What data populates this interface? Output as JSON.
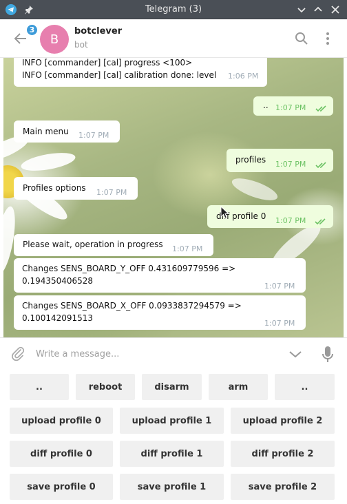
{
  "window": {
    "title": "Telegram (3)"
  },
  "header": {
    "unread_badge": "3",
    "avatar_letter": "B",
    "chat_name": "botclever",
    "chat_status": "bot"
  },
  "messages": [
    {
      "dir": "in",
      "lines": [
        "INFO  [commander] [cal] progress <100>",
        "INFO  [commander] [cal] calibration done: level"
      ],
      "time": "1:06 PM"
    },
    {
      "dir": "out",
      "text": "..",
      "time": "1:07 PM"
    },
    {
      "dir": "in",
      "text": "Main menu",
      "time": "1:07 PM"
    },
    {
      "dir": "out",
      "text": "profiles",
      "time": "1:07 PM"
    },
    {
      "dir": "in",
      "text": "Profiles options",
      "time": "1:07 PM"
    },
    {
      "dir": "out",
      "text": "diff profile 0",
      "time": "1:07 PM"
    },
    {
      "dir": "in",
      "text": "Please wait, operation in progress",
      "time": "1:07 PM"
    },
    {
      "dir": "in",
      "lines": [
        "Changes SENS_BOARD_Y_OFF 0.431609779596 =>",
        "0.194350406528"
      ],
      "time": "1:07 PM"
    },
    {
      "dir": "in",
      "lines": [
        "Changes SENS_BOARD_X_OFF 0.0933837294579 =>",
        "0.100142091513"
      ],
      "time": "1:07 PM"
    }
  ],
  "composer": {
    "placeholder": "Write a message..."
  },
  "keyboard": {
    "row1": [
      "..",
      "reboot",
      "disarm",
      "arm",
      ".."
    ],
    "row2": [
      "upload profile 0",
      "upload profile 1",
      "upload profile 2"
    ],
    "row3": [
      "diff profile 0",
      "diff profile 1",
      "diff profile 2"
    ],
    "row4": [
      "save profile 0",
      "save profile 1",
      "save profile 2"
    ]
  },
  "colors": {
    "titlebar": "#4a4f56",
    "accent": "#3d9bd9",
    "avatar": "#e77fae",
    "outgoing_bubble": "#effdde",
    "check": "#6cc264"
  }
}
